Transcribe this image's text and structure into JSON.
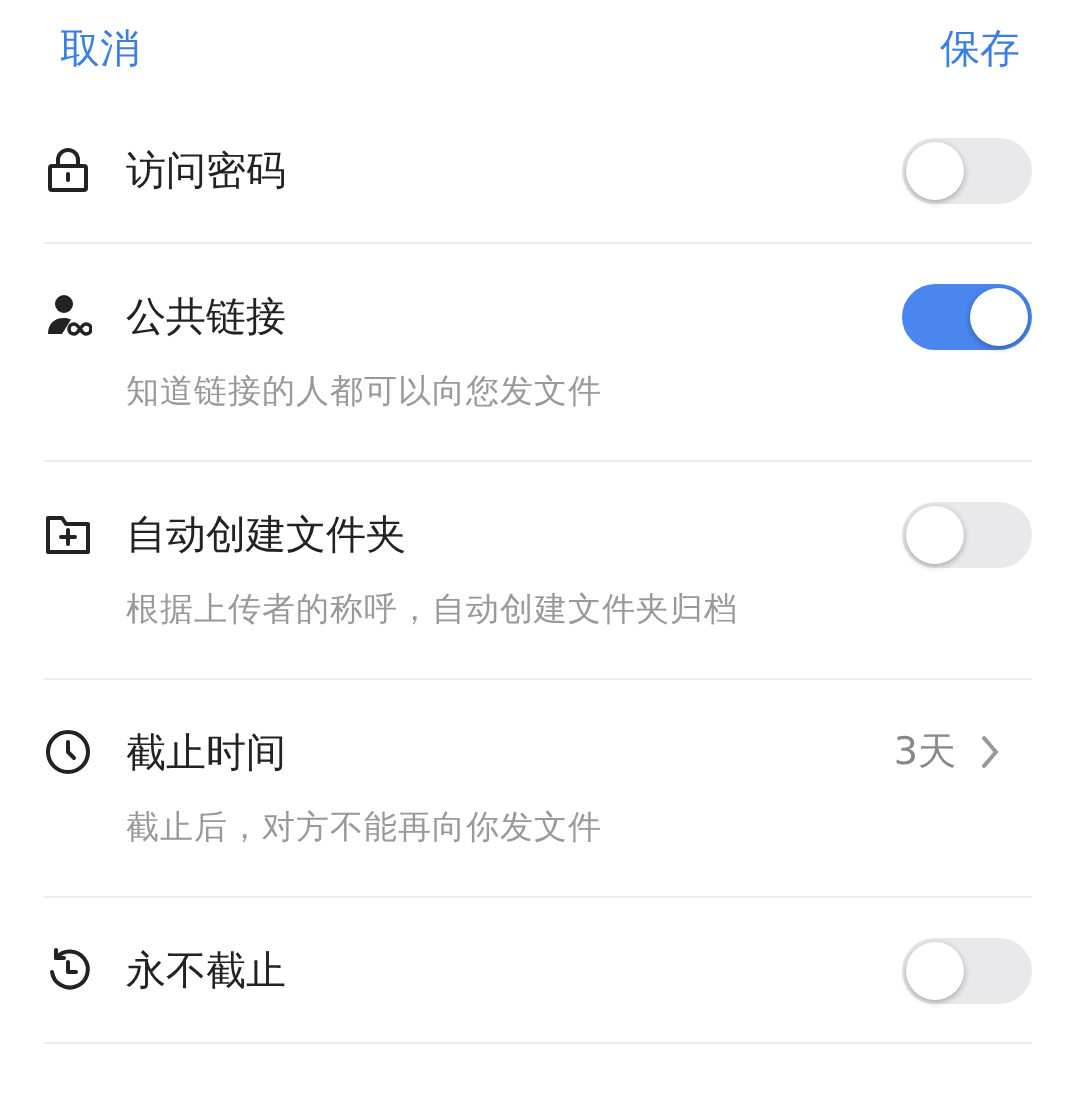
{
  "header": {
    "cancel": "取消",
    "save": "保存"
  },
  "rows": [
    {
      "title": "访问密码",
      "kind": "toggle",
      "on": false
    },
    {
      "title": "公共链接",
      "subtitle": "知道链接的人都可以向您发文件",
      "kind": "toggle",
      "on": true
    },
    {
      "title": "自动创建文件夹",
      "subtitle": "根据上传者的称呼，自动创建文件夹归档",
      "kind": "toggle",
      "on": false
    },
    {
      "title": "截止时间",
      "subtitle": "截止后，对方不能再向你发文件",
      "kind": "value",
      "value": "3天"
    },
    {
      "title": "永不截止",
      "kind": "toggle",
      "on": false
    }
  ]
}
